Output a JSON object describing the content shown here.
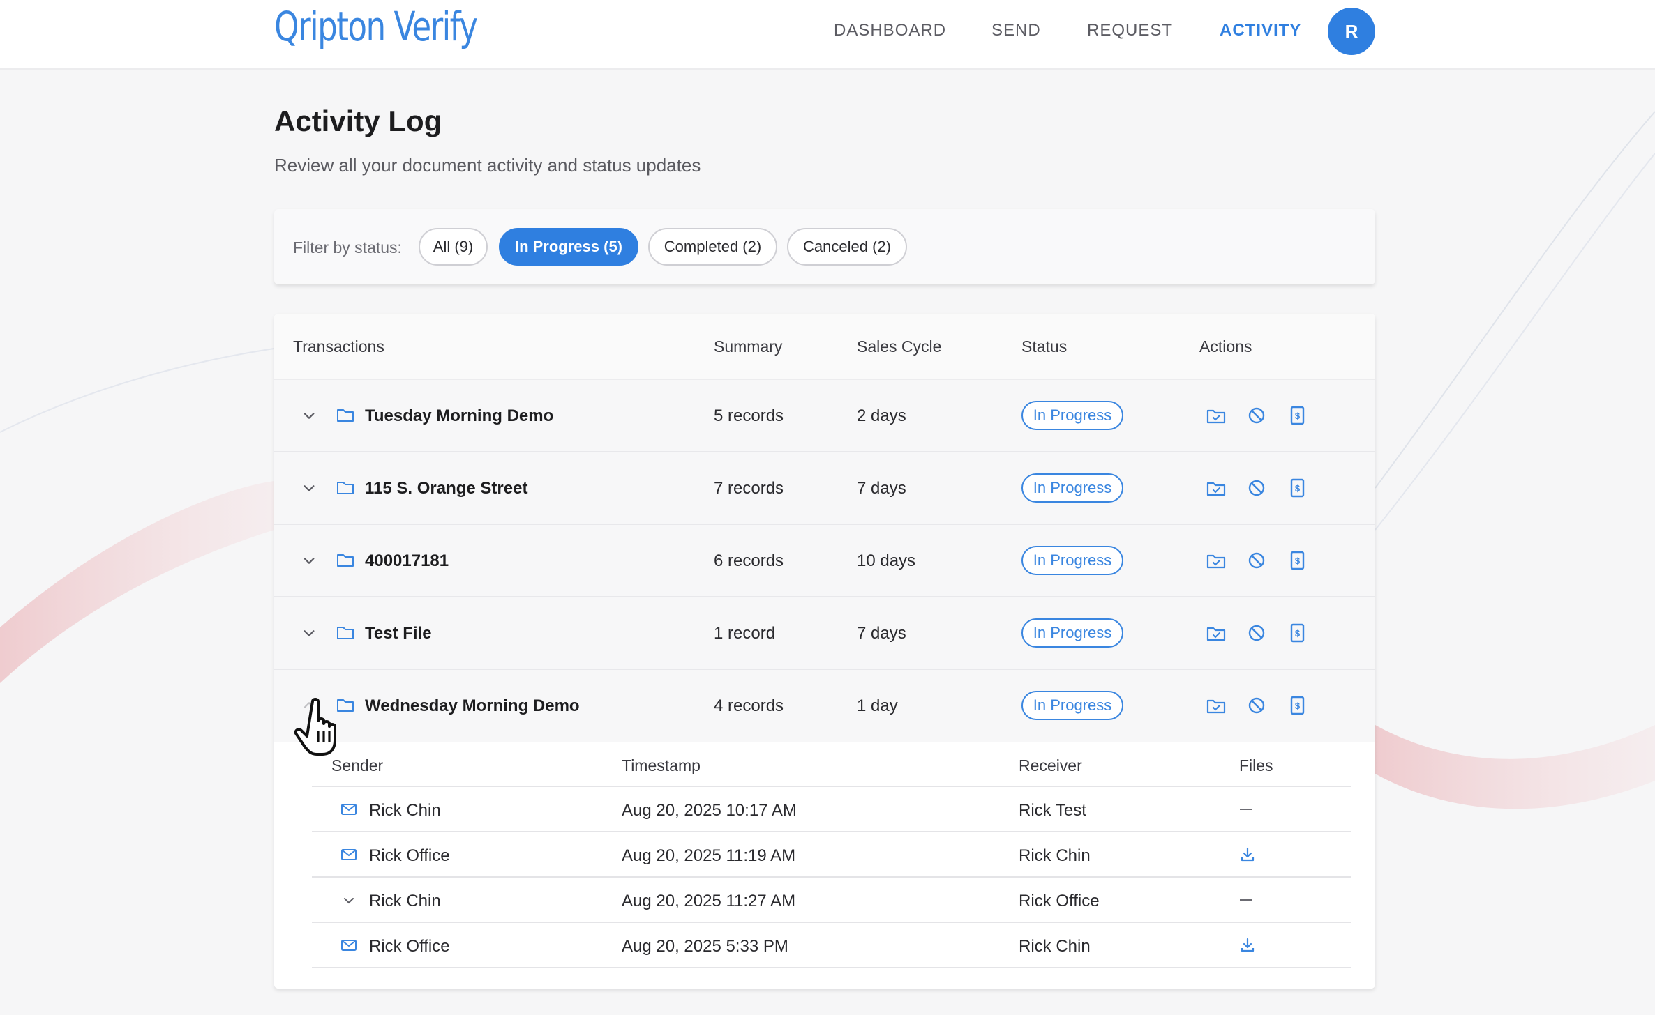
{
  "app": {
    "logo": "Qripton Verify",
    "nav": [
      "DASHBOARD",
      "SEND",
      "REQUEST",
      "ACTIVITY"
    ],
    "active_nav": "ACTIVITY",
    "avatar_initial": "R",
    "accent_color": "#2f7fe0"
  },
  "page": {
    "title": "Activity Log",
    "subtitle": "Review all your document activity and status updates"
  },
  "filter": {
    "label": "Filter by status:",
    "chips": [
      "All (9)",
      "In Progress (5)",
      "Completed (2)",
      "Canceled (2)"
    ],
    "selected": "In Progress (5)"
  },
  "table": {
    "headers": [
      "Transactions",
      "Summary",
      "Sales Cycle",
      "Status",
      "Actions"
    ],
    "rows": [
      {
        "name": "Tuesday Morning Demo",
        "summary": "5 records",
        "cycle": "2 days",
        "status": "In Progress"
      },
      {
        "name": "115 S. Orange Street",
        "summary": "7 records",
        "cycle": "7 days",
        "status": "In Progress"
      },
      {
        "name": "400017181",
        "summary": "6 records",
        "cycle": "10 days",
        "status": "In Progress"
      },
      {
        "name": "Test File",
        "summary": "1 record",
        "cycle": "7 days",
        "status": "In Progress"
      },
      {
        "name": "Wednesday Morning Demo",
        "summary": "4 records",
        "cycle": "1 day",
        "status": "In Progress"
      }
    ],
    "action_icons": [
      "folder-check-icon",
      "cancel-icon",
      "document-dollar-icon"
    ]
  },
  "detail": {
    "headers": [
      "Sender",
      "Timestamp",
      "Receiver",
      "Files"
    ],
    "rows": [
      {
        "sender": "Rick Chin",
        "timestamp": "Aug 20, 2025 10:17 AM",
        "receiver": "Rick Test",
        "file": "none",
        "icon": "mail-icon"
      },
      {
        "sender": "Rick Office",
        "timestamp": "Aug 20, 2025 11:19 AM",
        "receiver": "Rick Chin",
        "file": "download",
        "icon": "mail-icon"
      },
      {
        "sender": "Rick Chin",
        "timestamp": "Aug 20, 2025 11:27 AM",
        "receiver": "Rick Office",
        "file": "none",
        "icon": "check-icon"
      },
      {
        "sender": "Rick Office",
        "timestamp": "Aug 20, 2025 5:33 PM",
        "receiver": "Rick Chin",
        "file": "download",
        "icon": "mail-icon"
      }
    ]
  }
}
